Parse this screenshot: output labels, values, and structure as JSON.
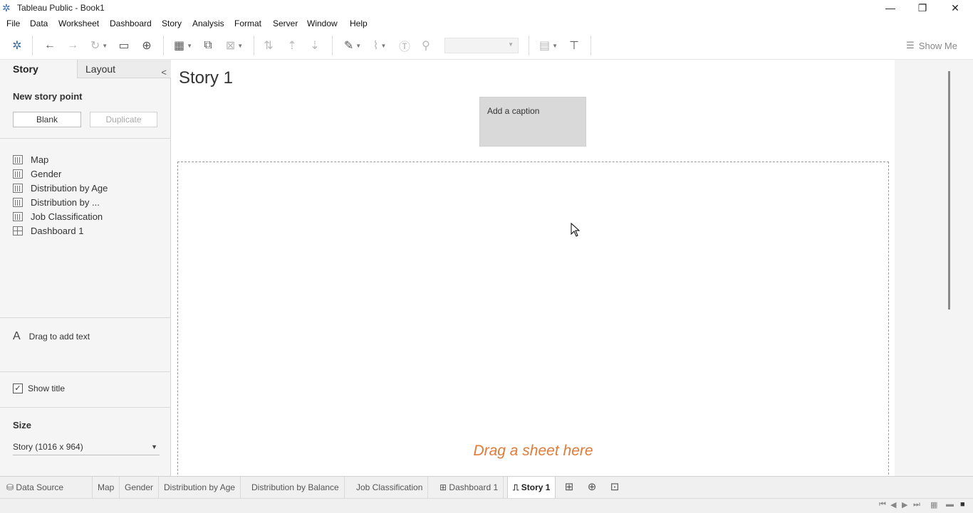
{
  "window": {
    "title": "Tableau Public - Book1",
    "minimize": "—",
    "restore": "❐",
    "close": "✕"
  },
  "menu": [
    "File",
    "Data",
    "Worksheet",
    "Dashboard",
    "Story",
    "Analysis",
    "Format",
    "Server",
    "Window",
    "Help"
  ],
  "toolbar": {
    "show_me": "Show Me",
    "icons": [
      "tableau-logo-icon",
      "undo-icon",
      "redo-icon",
      "replay-icon",
      "save-icon",
      "add-datasource-icon",
      "new-worksheet-icon",
      "duplicate-icon",
      "clear-icon",
      "swap-icon",
      "sort-ascending-icon",
      "sort-descending-icon",
      "highlight-icon",
      "group-icon",
      "labels-icon",
      "pin-icon",
      "fit-icon",
      "presentation-icon"
    ],
    "fit_value": ""
  },
  "left_panel": {
    "tab_story": "Story",
    "tab_layout": "Layout",
    "collapse": "<",
    "new_story_point": "New story point",
    "blank_button": "Blank",
    "duplicate_button": "Duplicate",
    "sheets": [
      {
        "label": "Map",
        "type": "worksheet"
      },
      {
        "label": "Gender",
        "type": "worksheet"
      },
      {
        "label": "Distribution by Age",
        "type": "worksheet"
      },
      {
        "label": "Distribution by ...",
        "type": "worksheet"
      },
      {
        "label": "Job Classification",
        "type": "worksheet"
      },
      {
        "label": "Dashboard 1",
        "type": "dashboard"
      }
    ],
    "drag_to_add_text": "Drag to add text",
    "show_title": "Show title",
    "show_title_checked": true,
    "size_title": "Size",
    "size_value": "Story (1016 x 964)"
  },
  "canvas": {
    "story_title": "Story 1",
    "caption": "Add a caption",
    "drop_hint": "Drag a sheet here"
  },
  "sheet_tabs": {
    "data_source": "Data Source",
    "tabs": [
      "Map",
      "Gender",
      "Distribution by Age",
      "Distribution by Balance",
      "Job Classification",
      "Dashboard 1",
      "Story 1"
    ],
    "active": "Story 1"
  },
  "colors": {
    "accent_orange": "#e07b39",
    "panel_bg": "#f5f5f5",
    "caption_bg": "#d9d9d9"
  }
}
